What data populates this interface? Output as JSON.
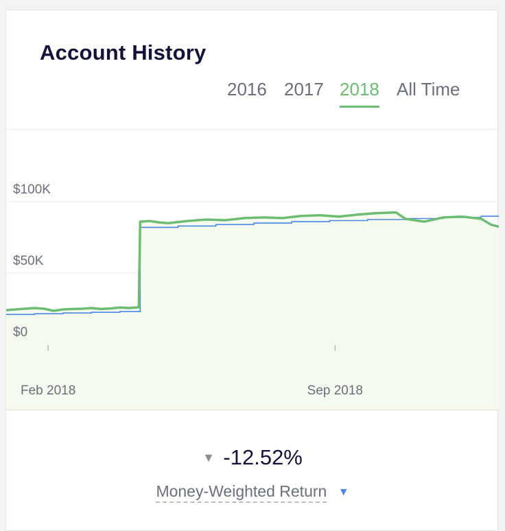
{
  "card": {
    "title": "Account History",
    "tabs": [
      {
        "label": "2016",
        "active": false
      },
      {
        "label": "2017",
        "active": false
      },
      {
        "label": "2018",
        "active": true
      },
      {
        "label": "All Time",
        "active": false
      }
    ]
  },
  "colors": {
    "accent_green": "#6cbd71",
    "deposits_blue": "#4a86e8",
    "area_fill": "#f5faef",
    "text_dark": "#12123a",
    "text_muted": "#6b6f7b"
  },
  "chart_data": {
    "type": "line",
    "title": "",
    "xlabel": "",
    "ylabel": "",
    "x_ticks": [
      "Feb 2018",
      "Sep 2018"
    ],
    "y_ticks": [
      "$100K",
      "$50K",
      "$0"
    ],
    "y_tick_values": [
      100000,
      50000,
      0
    ],
    "ylim": [
      0,
      100000
    ],
    "xlim": [
      "2018-01-01",
      "2018-12-31"
    ],
    "grid": true,
    "series": [
      {
        "name": "",
        "color": "#6cbd71",
        "filled": true,
        "x": [
          "2018-01-01",
          "2018-01-08",
          "2018-01-15",
          "2018-01-22",
          "2018-01-29",
          "2018-02-05",
          "2018-02-12",
          "2018-02-19",
          "2018-02-26",
          "2018-03-05",
          "2018-03-12",
          "2018-03-19",
          "2018-03-26",
          "2018-04-02",
          "2018-04-09",
          "2018-04-10",
          "2018-04-17",
          "2018-04-24",
          "2018-05-01",
          "2018-05-15",
          "2018-05-29",
          "2018-06-12",
          "2018-06-26",
          "2018-07-10",
          "2018-07-24",
          "2018-08-07",
          "2018-08-21",
          "2018-09-04",
          "2018-09-18",
          "2018-10-02",
          "2018-10-16",
          "2018-10-23",
          "2018-11-06",
          "2018-11-20",
          "2018-12-04",
          "2018-12-18",
          "2018-12-25",
          "2018-12-31"
        ],
        "values": [
          24000,
          24500,
          25000,
          25500,
          25000,
          23500,
          24500,
          24800,
          25000,
          25500,
          24800,
          25200,
          25800,
          25500,
          26000,
          86000,
          86500,
          85500,
          85000,
          86500,
          87500,
          87000,
          88500,
          89000,
          88500,
          90000,
          90500,
          89500,
          91000,
          92000,
          92500,
          88000,
          86000,
          89000,
          89500,
          88000,
          84000,
          82500
        ]
      },
      {
        "name": "",
        "color": "#4a86e8",
        "filled": false,
        "step": true,
        "x": [
          "2018-01-01",
          "2018-01-22",
          "2018-02-12",
          "2018-03-05",
          "2018-03-26",
          "2018-04-10",
          "2018-05-08",
          "2018-06-05",
          "2018-07-03",
          "2018-07-31",
          "2018-08-28",
          "2018-09-25",
          "2018-10-23",
          "2018-11-20",
          "2018-12-18",
          "2018-12-31"
        ],
        "values": [
          21000,
          21500,
          22000,
          22500,
          23000,
          82000,
          83000,
          84000,
          85000,
          86000,
          86800,
          87500,
          88200,
          89000,
          89800,
          90000
        ]
      }
    ]
  },
  "summary": {
    "direction_glyph": "▼",
    "return_value": "-12.52%",
    "metric_label": "Money-Weighted Return",
    "caret_glyph": "▼"
  }
}
